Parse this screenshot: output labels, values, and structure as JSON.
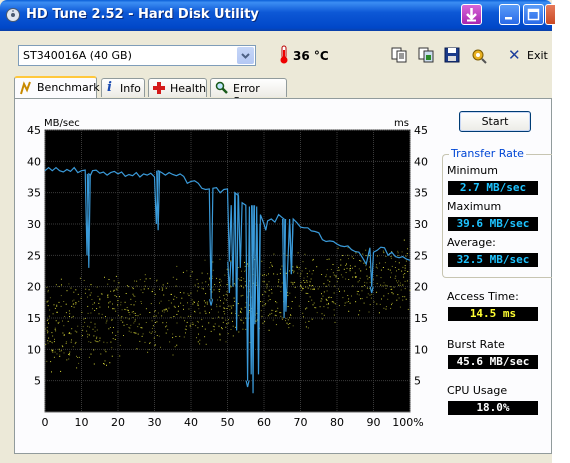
{
  "window": {
    "title": "HD Tune 2.52 - Hard Disk Utility"
  },
  "toolbar": {
    "drive": "ST340016A (40 GB)",
    "temperature": "36 °C",
    "exit_label": "Exit",
    "icons": [
      "copy-text-icon",
      "copy-screenshot-icon",
      "save-icon",
      "options-icon",
      "exit-icon"
    ]
  },
  "tabs": [
    {
      "label": "Benchmark",
      "icon": "benchmark-icon",
      "active": true
    },
    {
      "label": "Info",
      "icon": "info-icon"
    },
    {
      "label": "Health",
      "icon": "health-icon"
    },
    {
      "label": "Error Scan",
      "icon": "error-scan-icon"
    }
  ],
  "chart_data": {
    "type": "line",
    "ylabel_left": "MB/sec",
    "ylabel_right": "ms",
    "ylim": [
      0,
      45
    ],
    "yticks": [
      5,
      10,
      15,
      20,
      25,
      30,
      35,
      40,
      45
    ],
    "xticks": [
      "0",
      "10",
      "20",
      "30",
      "40",
      "50",
      "60",
      "70",
      "80",
      "90",
      "100%"
    ],
    "xlim": [
      0,
      100
    ],
    "grid": true,
    "background": "#000000",
    "series": [
      {
        "color": "#3a9ad9",
        "x": [
          0,
          1,
          2,
          3,
          4,
          5,
          6,
          7,
          8,
          9,
          10,
          11,
          11.5,
          12,
          12.5,
          13,
          14,
          15,
          16,
          17,
          18,
          19,
          20,
          21,
          22,
          23,
          24,
          25,
          26,
          27,
          28,
          29,
          30,
          30.5,
          31,
          32,
          33,
          34,
          35,
          36,
          37,
          38,
          39,
          40,
          41,
          42,
          43,
          44,
          45,
          45.5,
          46,
          47,
          48,
          49,
          50,
          50.5,
          51,
          51.5,
          52,
          53,
          53.5,
          54,
          55,
          55.5,
          56,
          56.5,
          57,
          57.5,
          58,
          58.5,
          59,
          60,
          60.5,
          61,
          62,
          63,
          64,
          65,
          65.5,
          66,
          67,
          67.5,
          68,
          69,
          70,
          71,
          72,
          73,
          74,
          75,
          76,
          77,
          78,
          79,
          80,
          81,
          82,
          83,
          84,
          85,
          86,
          87,
          88,
          89,
          89.5,
          90,
          91,
          92,
          93,
          94,
          95,
          96,
          97,
          98,
          99,
          100
        ],
        "y": [
          38.5,
          39,
          38.5,
          39,
          38.5,
          38.3,
          38.7,
          38.4,
          39,
          38.2,
          38.5,
          38.6,
          25,
          38,
          37.8,
          38.5,
          38.6,
          38.1,
          38.3,
          37.8,
          38.2,
          38.4,
          38,
          38.3,
          37.6,
          37.9,
          37.7,
          38.2,
          37.5,
          38,
          37.8,
          38.1,
          37.5,
          30,
          38.5,
          38.2,
          37.8,
          38.2,
          37.9,
          37.7,
          38,
          37.6,
          36.5,
          36.8,
          36.9,
          36.5,
          35.7,
          35.5,
          35.6,
          18,
          35.7,
          35.8,
          35,
          35.5,
          35.6,
          24,
          33,
          20,
          35,
          34.5,
          23,
          33.4,
          33,
          5,
          32.8,
          6,
          33,
          14,
          32.8,
          6,
          31.5,
          30,
          29,
          30.5,
          30.8,
          30.3,
          31.5,
          31,
          30.8,
          16,
          30.8,
          22,
          30.8,
          30.2,
          29.5,
          29.4,
          29.4,
          28.9,
          28.8,
          28.6,
          27.5,
          27.2,
          27.3,
          27.2,
          26.8,
          26.5,
          26.4,
          26.5,
          25.9,
          25.6,
          25.5,
          24.6,
          23.6,
          26.2,
          20,
          25.5,
          25.8,
          26.3,
          26.2,
          25,
          25.5,
          24.8,
          24.6,
          24.8,
          24.4,
          24.2
        ],
        "dips": [
          {
            "x": 12,
            "depth_to": 23
          },
          {
            "x": 31,
            "depth_to": 29
          },
          {
            "x": 45.5,
            "depth_to": 17
          },
          {
            "x": 50.5,
            "depth_to": 19
          },
          {
            "x": 52.5,
            "depth_to": 13
          },
          {
            "x": 55.5,
            "depth_to": 4
          },
          {
            "x": 57,
            "depth_to": 3
          },
          {
            "x": 58.5,
            "depth_to": 10
          },
          {
            "x": 65.5,
            "depth_to": 15
          },
          {
            "x": 67.5,
            "depth_to": 22
          },
          {
            "x": 89.5,
            "depth_to": 19
          }
        ]
      },
      {
        "color": "#e6e63c",
        "marker": "dots",
        "description_of_values": "access time scatter, ms",
        "band": {
          "x_from": 0,
          "x_to": 100,
          "y_low_start": 7,
          "y_high_start": 20,
          "y_low_end": 17,
          "y_high_end": 27
        }
      }
    ]
  },
  "buttons": {
    "start": "Start"
  },
  "transfer_rate": {
    "group_title": "Transfer Rate",
    "minimum_label": "Minimum",
    "minimum_value": "2.7 MB/sec",
    "maximum_label": "Maximum",
    "maximum_value": "39.6 MB/sec",
    "average_label": "Average:",
    "average_value": "32.5 MB/sec"
  },
  "access_time": {
    "label": "Access Time:",
    "value": "14.5 ms"
  },
  "burst_rate": {
    "label": "Burst Rate",
    "value": "45.6 MB/sec"
  },
  "cpu_usage": {
    "label": "CPU Usage",
    "value": "18.0%"
  },
  "colors": {
    "title_bar": "#0a5fd8",
    "transfer_line": "#3a9ad9",
    "access_dots": "#e6e63c",
    "value_blue": "#1ec3ff",
    "value_yellow": "#ffff33"
  }
}
